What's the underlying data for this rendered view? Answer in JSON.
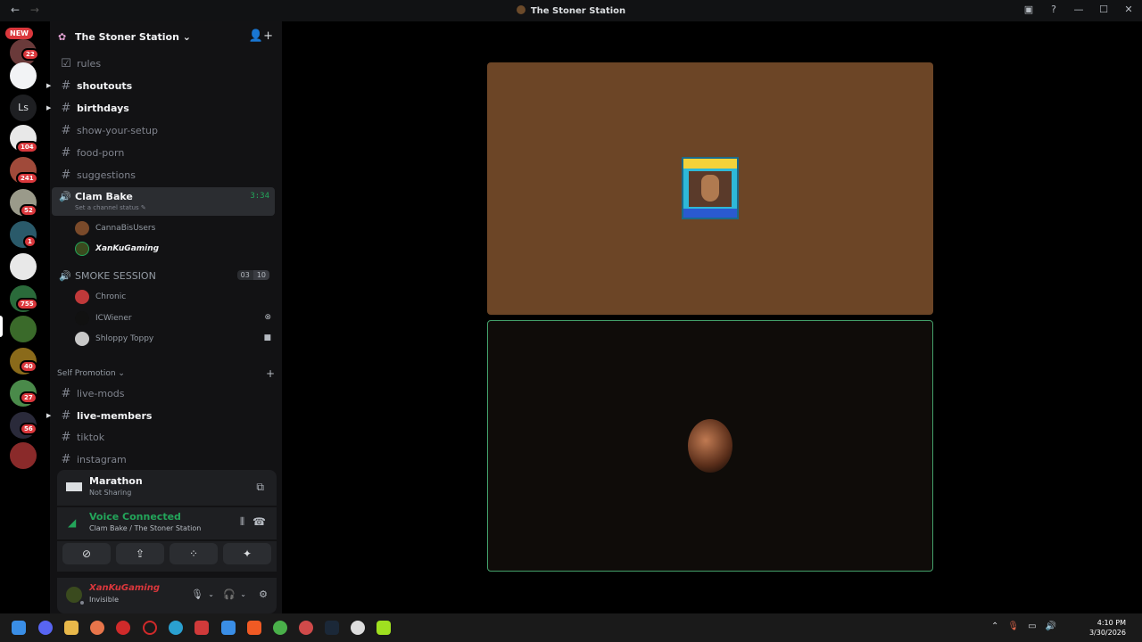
{
  "window": {
    "title": "The Stoner Station",
    "back": "←",
    "forward": "→"
  },
  "rail": {
    "new_label": "NEW",
    "initials": "Ls",
    "badges": [
      "22",
      "104",
      "241",
      "52",
      "1",
      "755",
      "40",
      "27",
      "56"
    ]
  },
  "server": {
    "name": "The Stoner Station ⌄",
    "flower_icon": "✿",
    "invite_icon": "👤+"
  },
  "channels": [
    {
      "name": "rules",
      "icon": "☑"
    },
    {
      "name": "shoutouts",
      "icon": "#"
    },
    {
      "name": "birthdays",
      "icon": "#"
    },
    {
      "name": "show-your-setup",
      "icon": "#"
    },
    {
      "name": "food-porn",
      "icon": "#"
    },
    {
      "name": "suggestions",
      "icon": "#"
    }
  ],
  "active_voice": {
    "name": "Clam Bake",
    "timer": "3:34",
    "status": "Set a channel status ✎",
    "users": [
      "CannaBisUsers",
      "XanKuGaming"
    ]
  },
  "smoke_session": {
    "name": "SMOKE SESSION",
    "count_a": "03",
    "count_b": "10",
    "users": [
      "Chronic",
      "ICWiener",
      "Shloppy Toppy"
    ]
  },
  "category": {
    "label": "Self Promotion ⌄",
    "plus": "+"
  },
  "promo_channels": [
    {
      "name": "live-mods"
    },
    {
      "name": "live-members"
    },
    {
      "name": "tiktok"
    },
    {
      "name": "instagram"
    }
  ],
  "activity": {
    "title": "Marathon",
    "subtitle": "Not Sharing"
  },
  "voice_connected": {
    "title": "Voice Connected",
    "subtitle": "Clam Bake / The Stoner Station"
  },
  "user": {
    "name": "XanKuGaming",
    "status": "Invisible"
  },
  "clock": {
    "time": "4:10 PM",
    "date": "3/30/2026"
  },
  "colors": {
    "accent_green": "#23a55a",
    "badge_red": "#da373c",
    "tile_brown": "#6c4526"
  }
}
